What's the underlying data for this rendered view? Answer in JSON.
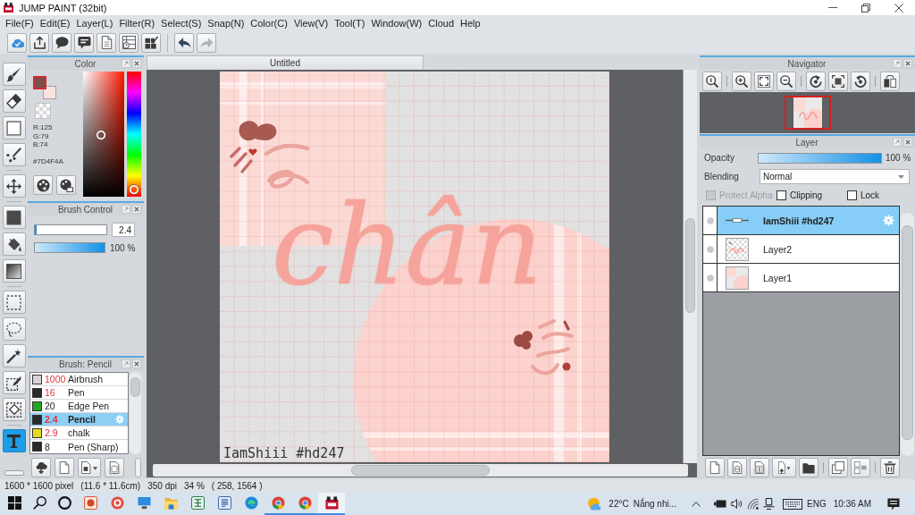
{
  "window": {
    "title": "JUMP PAINT (32bit)"
  },
  "menu": [
    "File(F)",
    "Edit(E)",
    "Layer(L)",
    "Filter(R)",
    "Select(S)",
    "Snap(N)",
    "Color(C)",
    "View(V)",
    "Tool(T)",
    "Window(W)",
    "Cloud",
    "Help"
  ],
  "toolbar": [
    {
      "disabled": false
    },
    {
      "disabled": false
    },
    {
      "disabled": false
    },
    {
      "disabled": false
    },
    {
      "disabled": false
    },
    {
      "disabled": false
    },
    {
      "disabled": false
    },
    {
      "disabled": false
    },
    {
      "disabled": true
    }
  ],
  "tools": [
    {
      "selected": false
    },
    {
      "selected": false
    },
    {
      "selected": false
    },
    {
      "selected": false
    },
    {
      "selected": false
    },
    {
      "selected": false
    },
    {
      "selected": false
    },
    {
      "selected": false
    },
    {
      "selected": false
    },
    {
      "selected": false
    },
    {
      "selected": false
    },
    {
      "selected": false
    },
    {
      "selected": false
    },
    {
      "selected": true
    }
  ],
  "color_panel": {
    "title": "Color",
    "swatches": [
      {
        "color": "#7d4f4a"
      },
      {
        "color": "#fbe2df"
      }
    ],
    "readouts": [
      "R:125",
      "G:79",
      "B:74"
    ],
    "hex": "#7D4F4A"
  },
  "brush_control": {
    "title": "Brush Control",
    "size": {
      "level": 0.02,
      "value": "2.4"
    },
    "opacity": {
      "level": 1,
      "reading": "100 %"
    }
  },
  "brush_panel": {
    "title": "Brush: Pencil",
    "brushes": [
      {
        "color": "#d4d4d4",
        "size": "1000",
        "size_marked": true,
        "name": "Airbrush",
        "selected": false
      },
      {
        "color": "#2a2a2a",
        "size": "16",
        "size_marked": true,
        "name": "Pen",
        "selected": false
      },
      {
        "color": "#1faa1f",
        "size": "20",
        "size_marked": false,
        "name": "Edge Pen",
        "selected": false
      },
      {
        "color": "#2a2a2a",
        "size": "2.4",
        "size_marked": true,
        "name": "Pencil",
        "selected": true
      },
      {
        "color": "#e8d820",
        "size": "2.9",
        "size_marked": true,
        "name": "chalk",
        "selected": false
      },
      {
        "color": "#2a2a2a",
        "size": "8",
        "size_marked": false,
        "name": "Pen (Sharp)",
        "selected": false
      }
    ]
  },
  "document": {
    "tab": "Untitled",
    "lettering": "chân",
    "signature": "IamShiii #hd247"
  },
  "navigator": {
    "title": "Navigator"
  },
  "layer_panel": {
    "title": "Layer",
    "opacity_label": "Opacity",
    "opacity": {
      "level": 1,
      "reading": "100 %"
    },
    "blending_label": "Blending",
    "blending": "Normal",
    "options": [
      {
        "label": "Protect Alpha",
        "checked": false,
        "disabled": true
      },
      {
        "label": "Clipping",
        "checked": false,
        "disabled": false
      },
      {
        "label": "Lock",
        "checked": false,
        "disabled": false
      }
    ],
    "layers": [
      {
        "name": "IamShiii #hd247",
        "selected": true
      },
      {
        "name": "Layer2",
        "selected": false
      },
      {
        "name": "Layer1",
        "selected": false
      }
    ]
  },
  "status_bar": [
    "1600 * 1600 pixel",
    "(11.6 * 11.6cm)",
    "350 dpi",
    "34 %",
    "( 258, 1564 )"
  ],
  "taskbar": {
    "apps": [
      {
        "running": false,
        "selected": false
      },
      {
        "running": false,
        "selected": false
      },
      {
        "running": false,
        "selected": false
      },
      {
        "running": false,
        "selected": false
      },
      {
        "running": false,
        "selected": false
      },
      {
        "running": false,
        "selected": false
      },
      {
        "running": false,
        "selected": false
      },
      {
        "running": true,
        "selected": false
      },
      {
        "running": true,
        "selected": false
      },
      {
        "running": true,
        "selected": true
      }
    ],
    "weather": {
      "temperature": "22°C",
      "condition": "Nắng nhi..."
    },
    "language": "ENG",
    "time": "10:36 AM"
  }
}
